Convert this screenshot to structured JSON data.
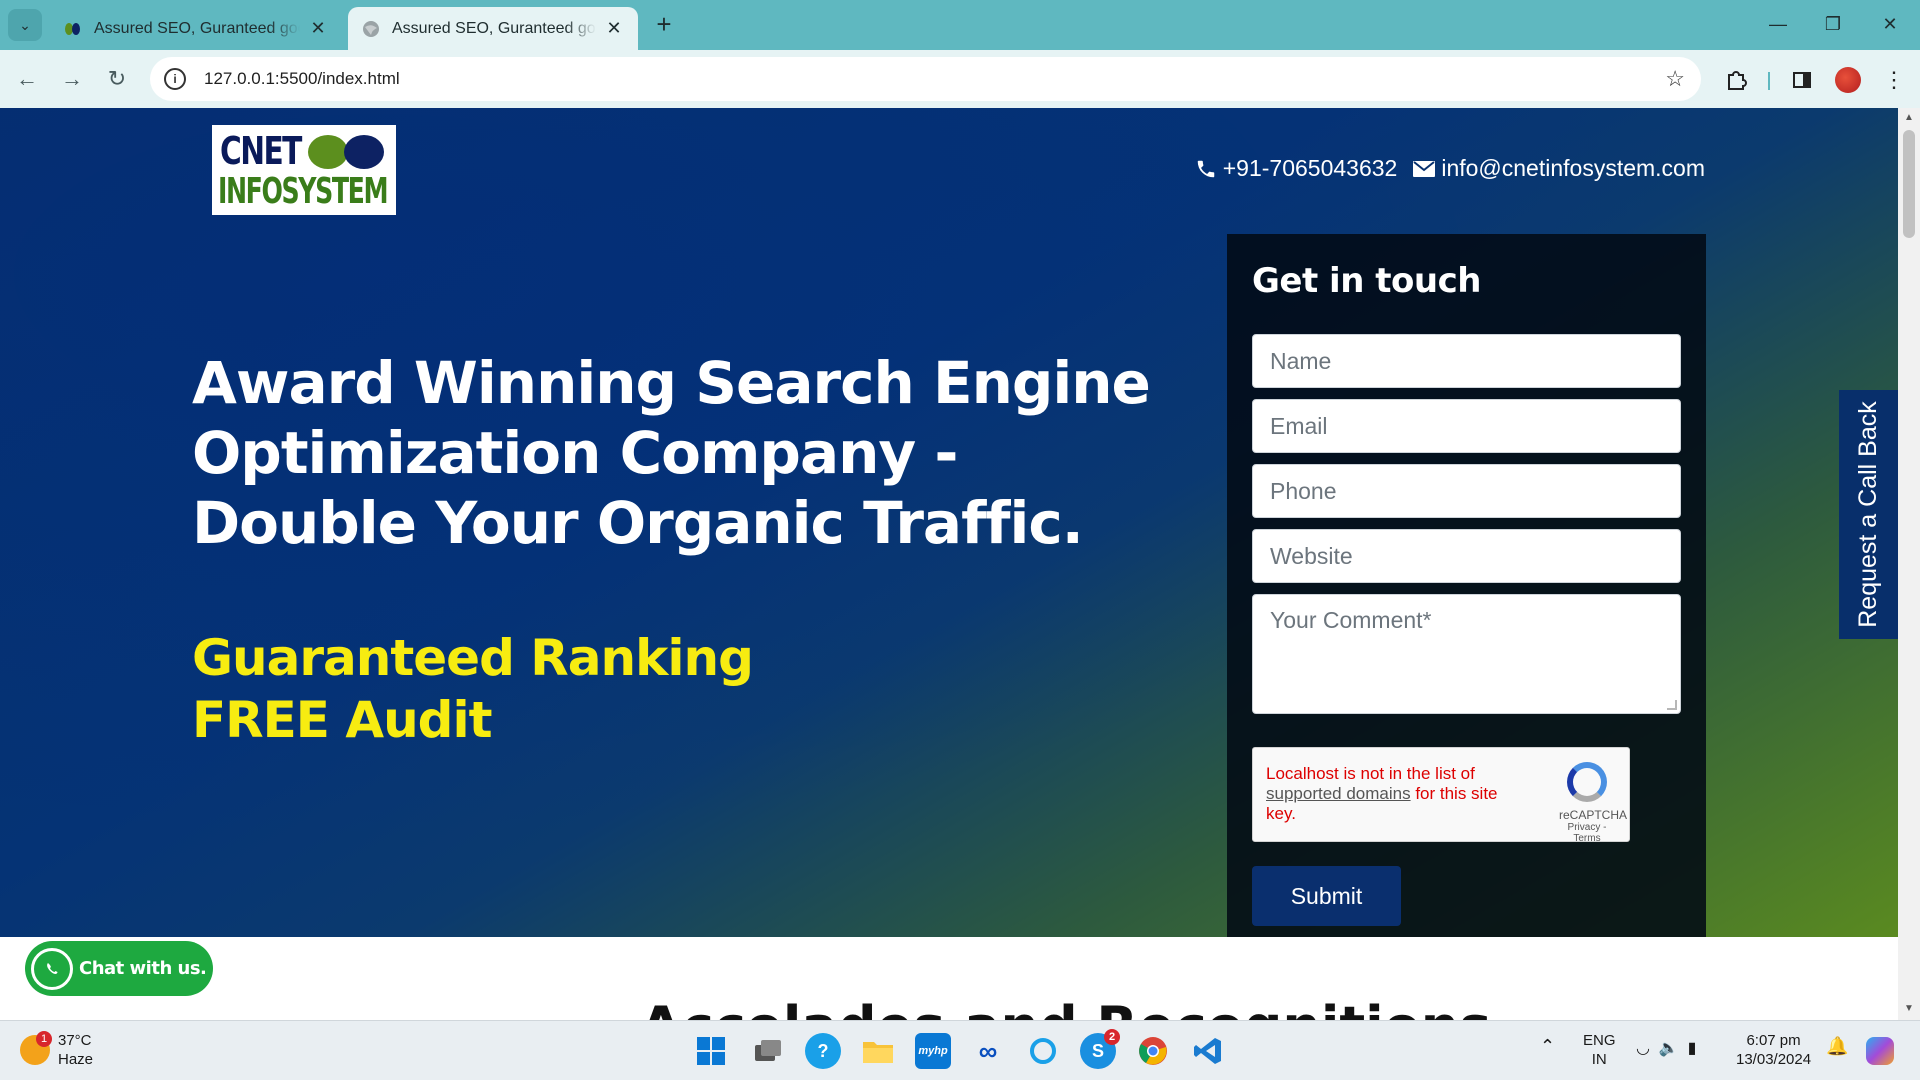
{
  "browser": {
    "tabs": [
      {
        "title": "Assured SEO, Guranteed google ranking",
        "active": false
      },
      {
        "title": "Assured SEO, Guranteed google ranking",
        "active": true
      }
    ],
    "url": "127.0.0.1:5500/index.html"
  },
  "header": {
    "logo_line1": "CNET",
    "logo_line2": "INFOSYSTEM",
    "phone": "+91-7065043632",
    "email": "info@cnetinfosystem.com"
  },
  "hero": {
    "headline": "Award Winning Search Engine Optimization Company - Double Your Organic Traffic.",
    "sub1": "Guaranteed Ranking",
    "sub2": "FREE Audit"
  },
  "form": {
    "title": "Get in touch",
    "name_placeholder": "Name",
    "email_placeholder": "Email",
    "phone_placeholder": "Phone",
    "website_placeholder": "Website",
    "comment_placeholder": "Your Comment*",
    "captcha_error_1": "Localhost is not in the list of",
    "captcha_link": "supported domains",
    "captcha_error_2": " for this site key.",
    "captcha_brand": "reCAPTCHA",
    "captcha_privacy": "Privacy - Terms",
    "submit_label": "Submit"
  },
  "side": {
    "callback_label": "Request a Call Back"
  },
  "chat": {
    "label": "Chat with us."
  },
  "next_section": {
    "title": "Accolades and Recognitions"
  },
  "taskbar": {
    "weather_temp": "37°C",
    "weather_desc": "Haze",
    "weather_badge": "1",
    "lang1": "ENG",
    "lang2": "IN",
    "time": "6:07 pm",
    "date": "13/03/2024",
    "skype_badge": "2"
  },
  "colors": {
    "accent_yellow": "#f7ec11",
    "navy": "#0a2f6e",
    "whatsapp_green": "#1ea940"
  }
}
